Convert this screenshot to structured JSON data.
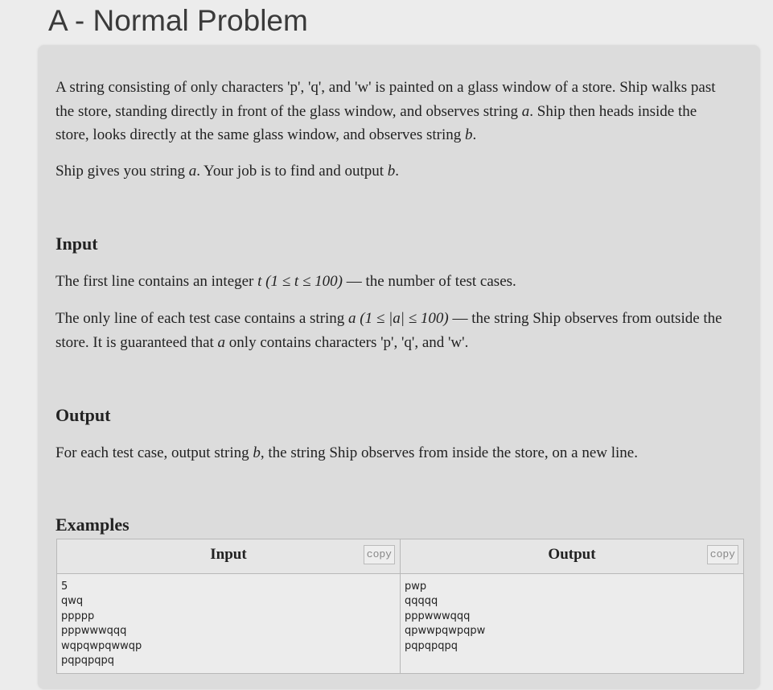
{
  "problem": {
    "title": "A - Normal Problem",
    "statement": {
      "p1_a": "A string consisting of only characters 'p', 'q', and 'w' is painted on a glass window of a store. Ship walks past the store, standing directly in front of the glass window, and observes string ",
      "p1_var_a": "a",
      "p1_b": ". Ship then heads inside the store, looks directly at the same glass window, and observes string ",
      "p1_var_b": "b",
      "p1_c": ".",
      "p2_a": "Ship gives you string ",
      "p2_var_a": "a",
      "p2_b": ". Your job is to find and output ",
      "p2_var_b": "b",
      "p2_c": "."
    },
    "input": {
      "heading": "Input",
      "p1_a": "The first line contains an integer ",
      "p1_math": "t (1 ≤ t ≤ 100)",
      "p1_b": " — the number of test cases.",
      "p2_a": "The only line of each test case contains a string ",
      "p2_math": "a (1 ≤ |a| ≤ 100)",
      "p2_b": " — the string Ship observes from outside the store. It is guaranteed that ",
      "p2_var": "a",
      "p2_c": " only contains characters 'p', 'q', and 'w'."
    },
    "output": {
      "heading": "Output",
      "p1_a": "For each test case, output string ",
      "p1_var": "b",
      "p1_b": ", the string Ship observes from inside the store, on a new line."
    },
    "examples": {
      "heading": "Examples",
      "input_label": "Input",
      "output_label": "Output",
      "copy_label": "copy",
      "input_lines": [
        "5",
        "qwq",
        "ppppp",
        "pppwwwqqq",
        "wqpqwpqwwqp",
        "pqpqpqpq"
      ],
      "output_lines": [
        "pwp",
        "qqqqq",
        "pppwwwqqq",
        "qpwwpqwpqpw",
        "pqpqpqpq"
      ]
    }
  }
}
